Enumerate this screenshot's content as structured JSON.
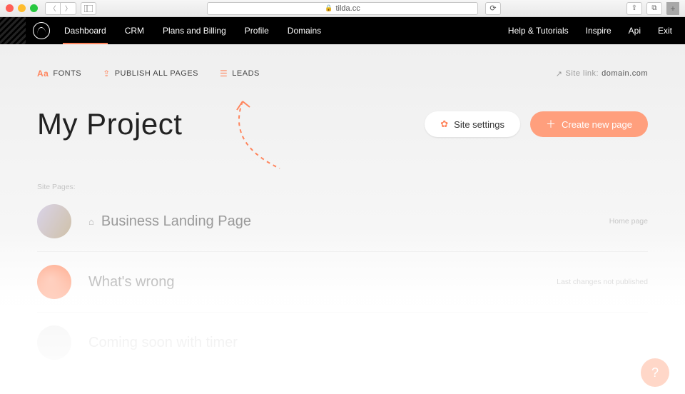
{
  "browser": {
    "url_host": "tilda.cc"
  },
  "nav": {
    "items": [
      "Dashboard",
      "CRM",
      "Plans and Billing",
      "Profile",
      "Domains"
    ],
    "right": [
      "Help & Tutorials",
      "Inspire",
      "Api",
      "Exit"
    ]
  },
  "tools": {
    "fonts": "FONTS",
    "publish": "PUBLISH ALL PAGES",
    "leads": "LEADS"
  },
  "sitelink": {
    "prefix": "Site link:",
    "domain": "domain.com"
  },
  "project": {
    "title": "My Project"
  },
  "buttons": {
    "settings": "Site settings",
    "create": "Create new page"
  },
  "list": {
    "label": "Site Pages:",
    "pages": [
      {
        "title": "Business Landing Page",
        "meta": "Home page",
        "home": true
      },
      {
        "title": "What's wrong",
        "meta": "Last changes not published"
      },
      {
        "title": "Coming soon with timer",
        "meta": ""
      }
    ]
  },
  "help": "?"
}
